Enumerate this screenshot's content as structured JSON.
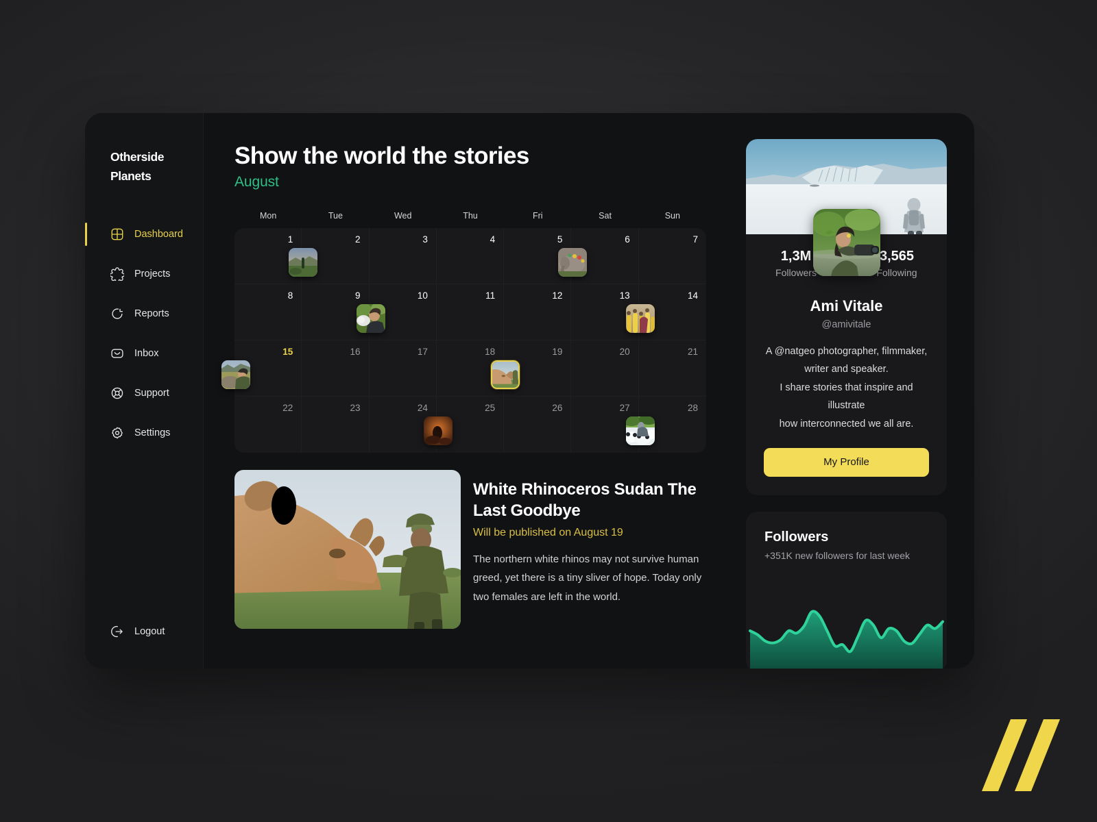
{
  "brand": {
    "line1": "Otherside",
    "line2": "Planets"
  },
  "sidebar": {
    "items": [
      {
        "label": "Dashboard",
        "icon": "dashboard-grid-icon",
        "active": true
      },
      {
        "label": "Projects",
        "icon": "puzzle-icon",
        "active": false
      },
      {
        "label": "Reports",
        "icon": "pie-chart-icon",
        "active": false
      },
      {
        "label": "Inbox",
        "icon": "envelope-icon",
        "active": false
      },
      {
        "label": "Support",
        "icon": "lifebuoy-icon",
        "active": false
      },
      {
        "label": "Settings",
        "icon": "gear-icon",
        "active": false
      }
    ],
    "logout": {
      "label": "Logout",
      "icon": "logout-arrow-icon"
    }
  },
  "header": {
    "title": "Show the world the stories",
    "subtitle": "August",
    "accent_color": "#2fbe86"
  },
  "calendar": {
    "weekdays": [
      "Mon",
      "Tue",
      "Wed",
      "Thu",
      "Fri",
      "Sat",
      "Sun"
    ],
    "today": 15,
    "selected": 19,
    "days": [
      {
        "num": 1,
        "dim": false,
        "thumb": null
      },
      {
        "num": 2,
        "dim": false,
        "thumb": "landscape-sunset-photo"
      },
      {
        "num": 3,
        "dim": false,
        "thumb": null
      },
      {
        "num": 4,
        "dim": false,
        "thumb": null
      },
      {
        "num": 5,
        "dim": false,
        "thumb": null
      },
      {
        "num": 6,
        "dim": false,
        "thumb": "decorated-elephant-photo"
      },
      {
        "num": 7,
        "dim": false,
        "thumb": null
      },
      {
        "num": 8,
        "dim": false,
        "thumb": null
      },
      {
        "num": 9,
        "dim": false,
        "thumb": null
      },
      {
        "num": 10,
        "dim": false,
        "thumb": "man-holding-animal-photo"
      },
      {
        "num": 11,
        "dim": false,
        "thumb": null
      },
      {
        "num": 12,
        "dim": false,
        "thumb": null
      },
      {
        "num": 13,
        "dim": false,
        "thumb": null
      },
      {
        "num": 14,
        "dim": false,
        "thumb": "yellow-robes-ceremony-photo"
      },
      {
        "num": 15,
        "dim": false,
        "thumb": "ranger-with-rhino-photo"
      },
      {
        "num": 16,
        "dim": true,
        "thumb": null
      },
      {
        "num": 17,
        "dim": true,
        "thumb": null
      },
      {
        "num": 18,
        "dim": true,
        "thumb": null
      },
      {
        "num": 19,
        "dim": true,
        "thumb": "white-rhino-photo"
      },
      {
        "num": 20,
        "dim": true,
        "thumb": null
      },
      {
        "num": 21,
        "dim": true,
        "thumb": null
      },
      {
        "num": 22,
        "dim": true,
        "thumb": null
      },
      {
        "num": 23,
        "dim": true,
        "thumb": null
      },
      {
        "num": 24,
        "dim": true,
        "thumb": null
      },
      {
        "num": 25,
        "dim": true,
        "thumb": "firelit-interior-photo"
      },
      {
        "num": 26,
        "dim": true,
        "thumb": null
      },
      {
        "num": 27,
        "dim": true,
        "thumb": null
      },
      {
        "num": 28,
        "dim": true,
        "thumb": "panda-keepers-photo"
      }
    ]
  },
  "article": {
    "image": "white-rhino-and-ranger-photo",
    "title": "White Rhinoceros Sudan The Last Goodbye",
    "publish_note": "Will be published on August 19",
    "publish_note_color": "#d9bf45",
    "body": "The northern white rhinos may not survive human greed, yet there is a tiny sliver of hope. Today only two females are left in the world."
  },
  "profile": {
    "cover_image": "arctic-snowfield-photo",
    "avatar_image": "photographer-in-river-photo",
    "followers_value": "1,3M",
    "followers_label": "Followers",
    "following_value": "3,565",
    "following_label": "Following",
    "name": "Ami Vitale",
    "handle": "@amivitale",
    "bio_line1": "A @natgeo photographer, filmmaker,",
    "bio_line2": "writer and speaker.",
    "bio_line3": "I share stories that inspire and illustrate",
    "bio_line4": "how interconnected we all are.",
    "button_label": "My Profile",
    "button_color": "#f3dd58"
  },
  "followers_panel": {
    "title": "Followers",
    "subtitle": "+351K new followers for last week"
  },
  "chart_data": {
    "type": "area",
    "title": "Followers",
    "subtitle": "+351K new followers for last week",
    "xlabel": "",
    "ylabel": "",
    "grid": false,
    "legend": false,
    "line_color": "#2fd39a",
    "fill_top_color": "#1f9e78",
    "fill_bottom_color": "#0d4a3a",
    "x": [
      0,
      1,
      2,
      3,
      4,
      5,
      6,
      7,
      8,
      9,
      10,
      11,
      12,
      13,
      14,
      15,
      16,
      17,
      18,
      19,
      20,
      21,
      22,
      23,
      24,
      25
    ],
    "values": [
      62,
      55,
      44,
      41,
      47,
      62,
      58,
      70,
      95,
      88,
      62,
      36,
      38,
      26,
      52,
      80,
      72,
      50,
      66,
      62,
      44,
      40,
      56,
      72,
      66,
      78
    ],
    "ylim": [
      0,
      100
    ],
    "series": [
      {
        "name": "New followers",
        "values": [
          62,
          55,
          44,
          41,
          47,
          62,
          58,
          70,
          95,
          88,
          62,
          36,
          38,
          26,
          52,
          80,
          72,
          50,
          66,
          62,
          44,
          40,
          56,
          72,
          66,
          78
        ]
      }
    ]
  },
  "corner_logo": {
    "name": "double-slash-logo",
    "color": "#f0d64a"
  }
}
